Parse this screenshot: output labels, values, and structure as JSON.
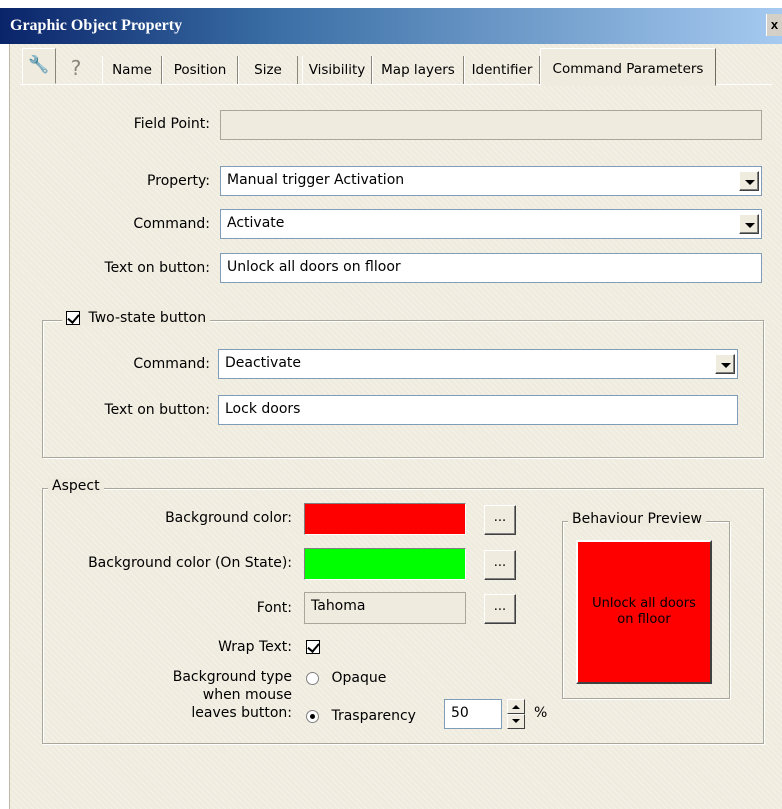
{
  "window": {
    "title": "Graphic Object Property",
    "close_glyph": "x"
  },
  "tabs": [
    {
      "label": "",
      "icon": "wrench-icon"
    },
    {
      "label": "",
      "icon": "question-icon"
    },
    {
      "label": "Name"
    },
    {
      "label": "Position"
    },
    {
      "label": "Size"
    },
    {
      "label": "Visibility"
    },
    {
      "label": "Map layers"
    },
    {
      "label": "Identifier"
    },
    {
      "label": "Command Parameters",
      "active": true
    }
  ],
  "form": {
    "field_point": {
      "label": "Field Point:",
      "value": ""
    },
    "property": {
      "label": "Property:",
      "value": "Manual trigger Activation"
    },
    "command": {
      "label": "Command:",
      "value": "Activate"
    },
    "text_on_button": {
      "label": "Text on button:",
      "value": "Unlock all doors on flloor"
    }
  },
  "two_state": {
    "label": "Two-state button",
    "checked": true,
    "command": {
      "label": "Command:",
      "value": "Deactivate"
    },
    "text_on_button": {
      "label": "Text on button:",
      "value": "Lock doors"
    }
  },
  "aspect": {
    "title": "Aspect",
    "background_color": {
      "label": "Background color:",
      "color": "#ff0000"
    },
    "background_color_on": {
      "label": "Background color (On State):",
      "color": "#00ff00"
    },
    "font": {
      "label": "Font:",
      "value": "Tahoma"
    },
    "wrap_text": {
      "label": "Wrap Text:",
      "checked": true
    },
    "background_type": {
      "label_lines": [
        "Background type",
        "when mouse",
        "leaves button:"
      ],
      "options": [
        "Opaque",
        "Trasparency"
      ],
      "selected": "Trasparency",
      "transparency_value": "50",
      "unit": "%"
    },
    "browse_label": "...",
    "preview": {
      "title": "Behaviour Preview",
      "text": "Unlock all doors on flloor",
      "color": "#ff0000"
    }
  }
}
